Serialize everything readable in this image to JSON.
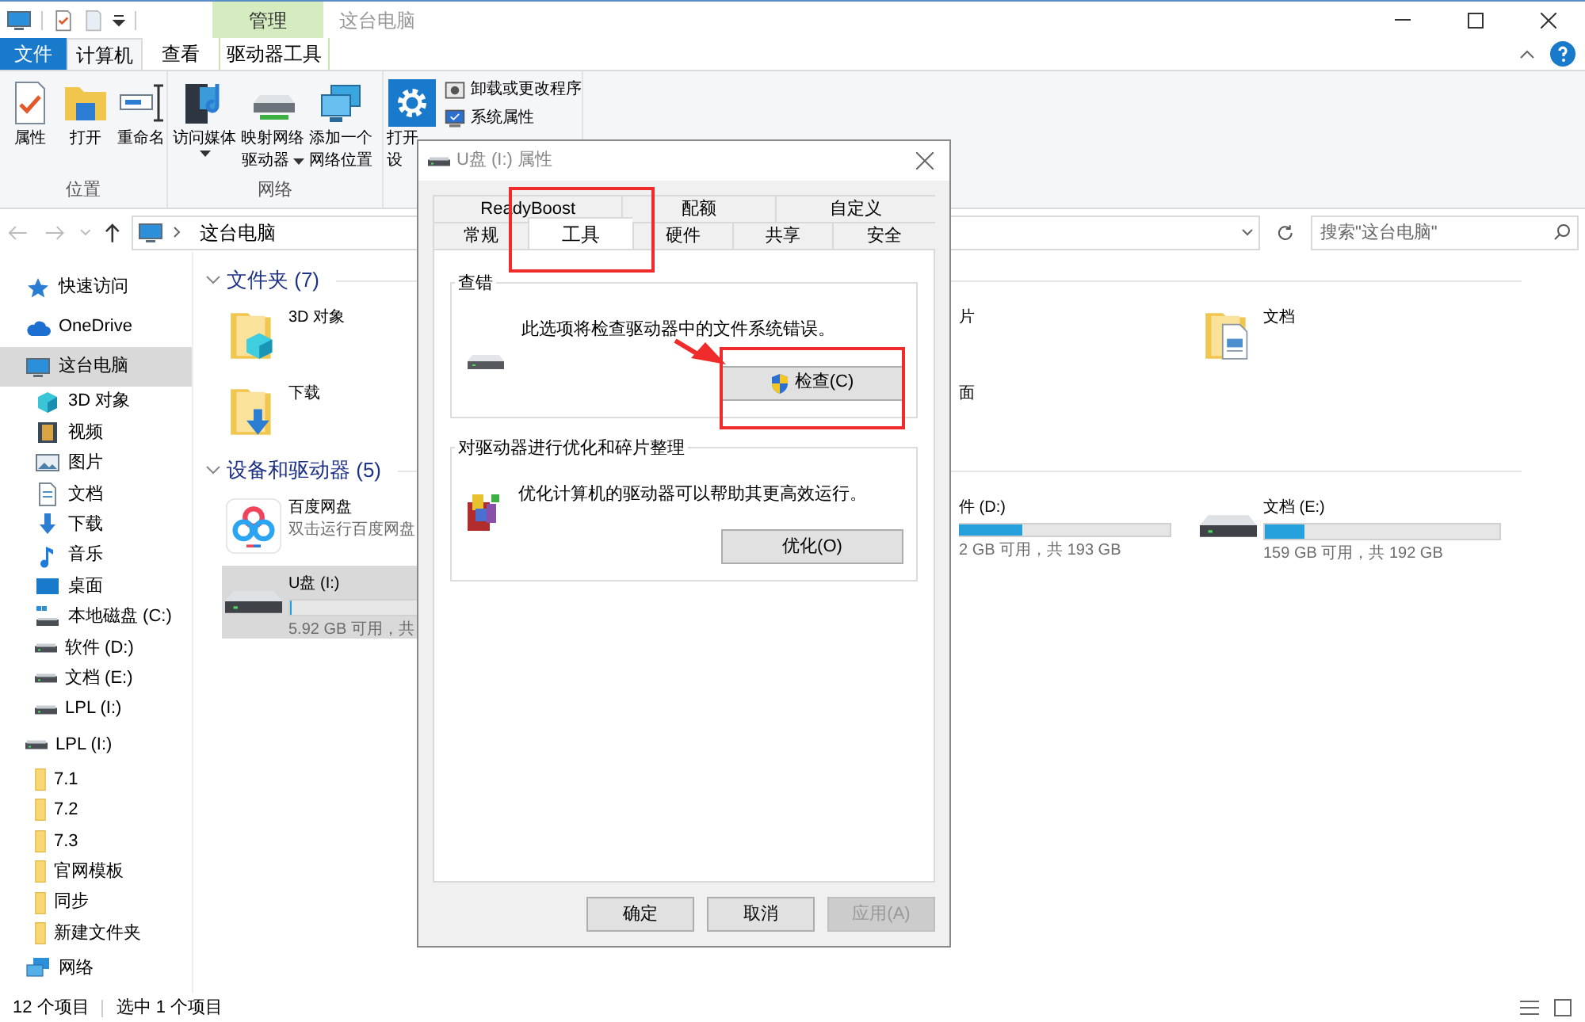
{
  "window": {
    "title": "这台电脑",
    "context_group": "管理"
  },
  "ribbon_tabs": [
    {
      "label": "文件",
      "kind": "file",
      "selected": false
    },
    {
      "label": "计算机",
      "kind": "normal",
      "selected": true
    },
    {
      "label": "查看",
      "kind": "normal",
      "selected": false
    },
    {
      "label": "驱动器工具",
      "kind": "context",
      "selected": false
    }
  ],
  "ribbon_groups": [
    {
      "label": "位置",
      "buttons": [
        {
          "lines": [
            "属性"
          ],
          "kind": "properties",
          "dropdown": false
        },
        {
          "lines": [
            "打开"
          ],
          "kind": "open",
          "dropdown": false
        },
        {
          "lines": [
            "重命名"
          ],
          "kind": "rename",
          "dropdown": false
        }
      ]
    },
    {
      "label": "网络",
      "buttons": [
        {
          "lines": [
            "访问媒体"
          ],
          "kind": "media",
          "dropdown": true
        },
        {
          "lines": [
            "映射网络",
            "驱动器"
          ],
          "kind": "map-drive",
          "dropdown": true
        },
        {
          "lines": [
            "添加一个",
            "网络位置"
          ],
          "kind": "net-location",
          "dropdown": false
        }
      ]
    },
    {
      "buttons": [
        {
          "lines": [
            "打开",
            "设"
          ],
          "kind": "settings",
          "dropdown": false
        }
      ],
      "small_buttons": [
        {
          "label": "卸载或更改程序",
          "kind": "uninstall"
        },
        {
          "label": "系统属性",
          "kind": "sys-props"
        }
      ]
    }
  ],
  "address": {
    "path": "这台电脑"
  },
  "search": {
    "placeholder": "搜索\"这台电脑\""
  },
  "sidebar": [
    {
      "label": "快速访问",
      "kind": "star",
      "selected": false
    },
    {
      "label": "OneDrive",
      "kind": "cloud",
      "selected": false
    },
    {
      "label": "这台电脑",
      "kind": "pc",
      "selected": true,
      "children": [
        {
          "label": "3D 对象",
          "kind": "cube",
          "selected": false
        },
        {
          "label": "视频",
          "kind": "video",
          "selected": false
        },
        {
          "label": "图片",
          "kind": "picture",
          "selected": false
        },
        {
          "label": "文档",
          "kind": "doc",
          "selected": false
        },
        {
          "label": "下载",
          "kind": "download",
          "selected": false
        },
        {
          "label": "音乐",
          "kind": "music",
          "selected": false
        },
        {
          "label": "桌面",
          "kind": "desktop",
          "selected": false
        },
        {
          "label": "本地磁盘 (C:)",
          "kind": "drive-c",
          "selected": false
        },
        {
          "label": "软件 (D:)",
          "kind": "drive",
          "selected": false
        },
        {
          "label": "文档 (E:)",
          "kind": "drive",
          "selected": false
        },
        {
          "label": "LPL (I:)",
          "kind": "drive",
          "selected": false
        }
      ]
    },
    {
      "label": "LPL (I:)",
      "kind": "drive",
      "selected": false,
      "children": [
        {
          "label": "7.1",
          "kind": "folder",
          "selected": false
        },
        {
          "label": "7.2",
          "kind": "folder",
          "selected": false
        },
        {
          "label": "7.3",
          "kind": "folder",
          "selected": false
        },
        {
          "label": "官网模板",
          "kind": "folder",
          "selected": false
        },
        {
          "label": "同步",
          "kind": "folder",
          "selected": false
        },
        {
          "label": "新建文件夹",
          "kind": "folder",
          "selected": false
        }
      ]
    },
    {
      "label": "网络",
      "kind": "network",
      "selected": false
    }
  ],
  "sections": [
    {
      "title": "文件夹 (7)",
      "rows": [
        [
          {
            "name": "3D 对象",
            "kind": "folder-3d",
            "clipped": false,
            "selected": false
          },
          {
            "name": "片",
            "kind": "folder",
            "clipped": true,
            "selected": false
          },
          {
            "name": "文档",
            "kind": "folder-doc",
            "clipped": false,
            "selected": false
          }
        ],
        [
          {
            "name": "下载",
            "kind": "folder-download",
            "clipped": false,
            "selected": false
          },
          {
            "name": "面",
            "kind": "folder",
            "clipped": true,
            "selected": false
          }
        ]
      ]
    },
    {
      "title": "设备和驱动器 (5)",
      "rows": [
        [
          {
            "name": "百度网盘",
            "kind": "app",
            "subtitle": "双击运行百度网盘",
            "clipped": false,
            "selected": false
          },
          {
            "name": "件 (D:)",
            "kind": "drive",
            "level": 0.3,
            "subtitle": "2 GB 可用，共 193 GB",
            "clipped": true,
            "selected": false
          },
          {
            "name": "文档 (E:)",
            "kind": "drive",
            "level": 0.17,
            "subtitle": "159 GB 可用，共 192 GB",
            "clipped": false,
            "selected": false
          }
        ],
        [
          {
            "name": "U盘 (I:)",
            "kind": "drive",
            "level": 0.01,
            "subtitle": "5.92 GB 可用，共",
            "clipped": false,
            "selected": true
          }
        ]
      ]
    }
  ],
  "status_bar": {
    "count": "12 个项目",
    "selection": "选中 1 个项目"
  },
  "dialog": {
    "title": "U盘 (I:) 属性",
    "tab_rows": [
      [
        {
          "label": "ReadyBoost",
          "selected": false
        },
        {
          "label": "配额",
          "selected": false
        },
        {
          "label": "自定义",
          "selected": false
        }
      ],
      [
        {
          "label": "常规",
          "selected": false
        },
        {
          "label": "工具",
          "selected": true
        },
        {
          "label": "硬件",
          "selected": false
        },
        {
          "label": "共享",
          "selected": false
        },
        {
          "label": "安全",
          "selected": false
        }
      ]
    ],
    "groups": [
      {
        "title": "查错",
        "kind": "check",
        "text": "此选项将检查驱动器中的文件系统错误。",
        "button": "检查(C)"
      },
      {
        "title": "对驱动器进行优化和碎片整理",
        "kind": "defrag",
        "text": "优化计算机的驱动器可以帮助其更高效运行。",
        "button": "优化(O)"
      }
    ],
    "buttons": [
      {
        "label": "确定",
        "disabled": false
      },
      {
        "label": "取消",
        "disabled": false
      },
      {
        "label": "应用(A)",
        "disabled": true
      }
    ]
  }
}
